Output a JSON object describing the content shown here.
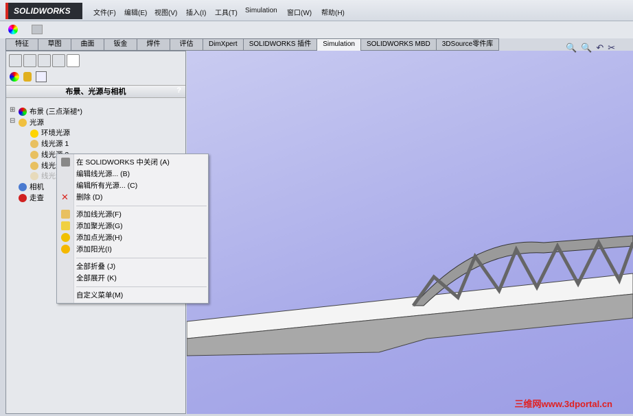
{
  "app": {
    "logo": "SOLIDWORKS"
  },
  "menu": [
    "文件(F)",
    "编辑(E)",
    "视图(V)",
    "插入(I)",
    "工具(T)",
    "Simulation",
    "窗口(W)",
    "帮助(H)"
  ],
  "tabs": [
    {
      "label": "特征"
    },
    {
      "label": "草图"
    },
    {
      "label": "曲面"
    },
    {
      "label": "钣金"
    },
    {
      "label": "焊件"
    },
    {
      "label": "评估"
    },
    {
      "label": "DimXpert"
    },
    {
      "label": "SOLIDWORKS 插件"
    },
    {
      "label": "Simulation",
      "active": true
    },
    {
      "label": "SOLIDWORKS MBD"
    },
    {
      "label": "3DSource零件库"
    }
  ],
  "panel": {
    "title": "布景、光源与相机",
    "tree": [
      {
        "label": "布景 (三点渐褪*)",
        "level": 0,
        "icon": "scene-icon"
      },
      {
        "label": "光源",
        "level": 0,
        "icon": "lights-folder-icon"
      },
      {
        "label": "环境光源",
        "level": 1,
        "icon": "bulb-icon"
      },
      {
        "label": "线光源 1",
        "level": 1,
        "icon": "directional-light-icon"
      },
      {
        "label": "线光源 2",
        "level": 1,
        "icon": "directional-light-icon"
      },
      {
        "label": "线光源 3",
        "level": 1,
        "icon": "directional-light-icon"
      },
      {
        "label": "线光源 4",
        "level": 1,
        "icon": "directional-light-icon",
        "disabled": true
      },
      {
        "label": "相机",
        "level": 0,
        "icon": "camera-icon"
      },
      {
        "label": "走查",
        "level": 0,
        "icon": "walkthrough-icon"
      }
    ]
  },
  "context_menu": {
    "groups": [
      [
        {
          "label": "在 SOLIDWORKS 中关闭 (A)",
          "icon": "close-in-solidworks-icon"
        },
        {
          "label": "编辑线光源... (B)"
        },
        {
          "label": "编辑所有光源... (C)"
        },
        {
          "label": "删除 (D)",
          "icon": "delete-x-icon"
        }
      ],
      [
        {
          "label": "添加线光源(F)",
          "icon": "directional-light-icon"
        },
        {
          "label": "添加聚光源(G)",
          "icon": "spot-light-icon"
        },
        {
          "label": "添加点光源(H)",
          "icon": "point-light-icon"
        },
        {
          "label": "添加阳光(I)",
          "icon": "sun-icon"
        }
      ],
      [
        {
          "label": "全部折叠 (J)"
        },
        {
          "label": "全部展开 (K)"
        }
      ],
      [
        {
          "label": "自定义菜单(M)"
        }
      ]
    ]
  },
  "watermark": "三维网www.3dportal.cn",
  "colors": {
    "viewport": "#a9abe9",
    "delete": "#d8261f",
    "watermark": "#e02020"
  }
}
